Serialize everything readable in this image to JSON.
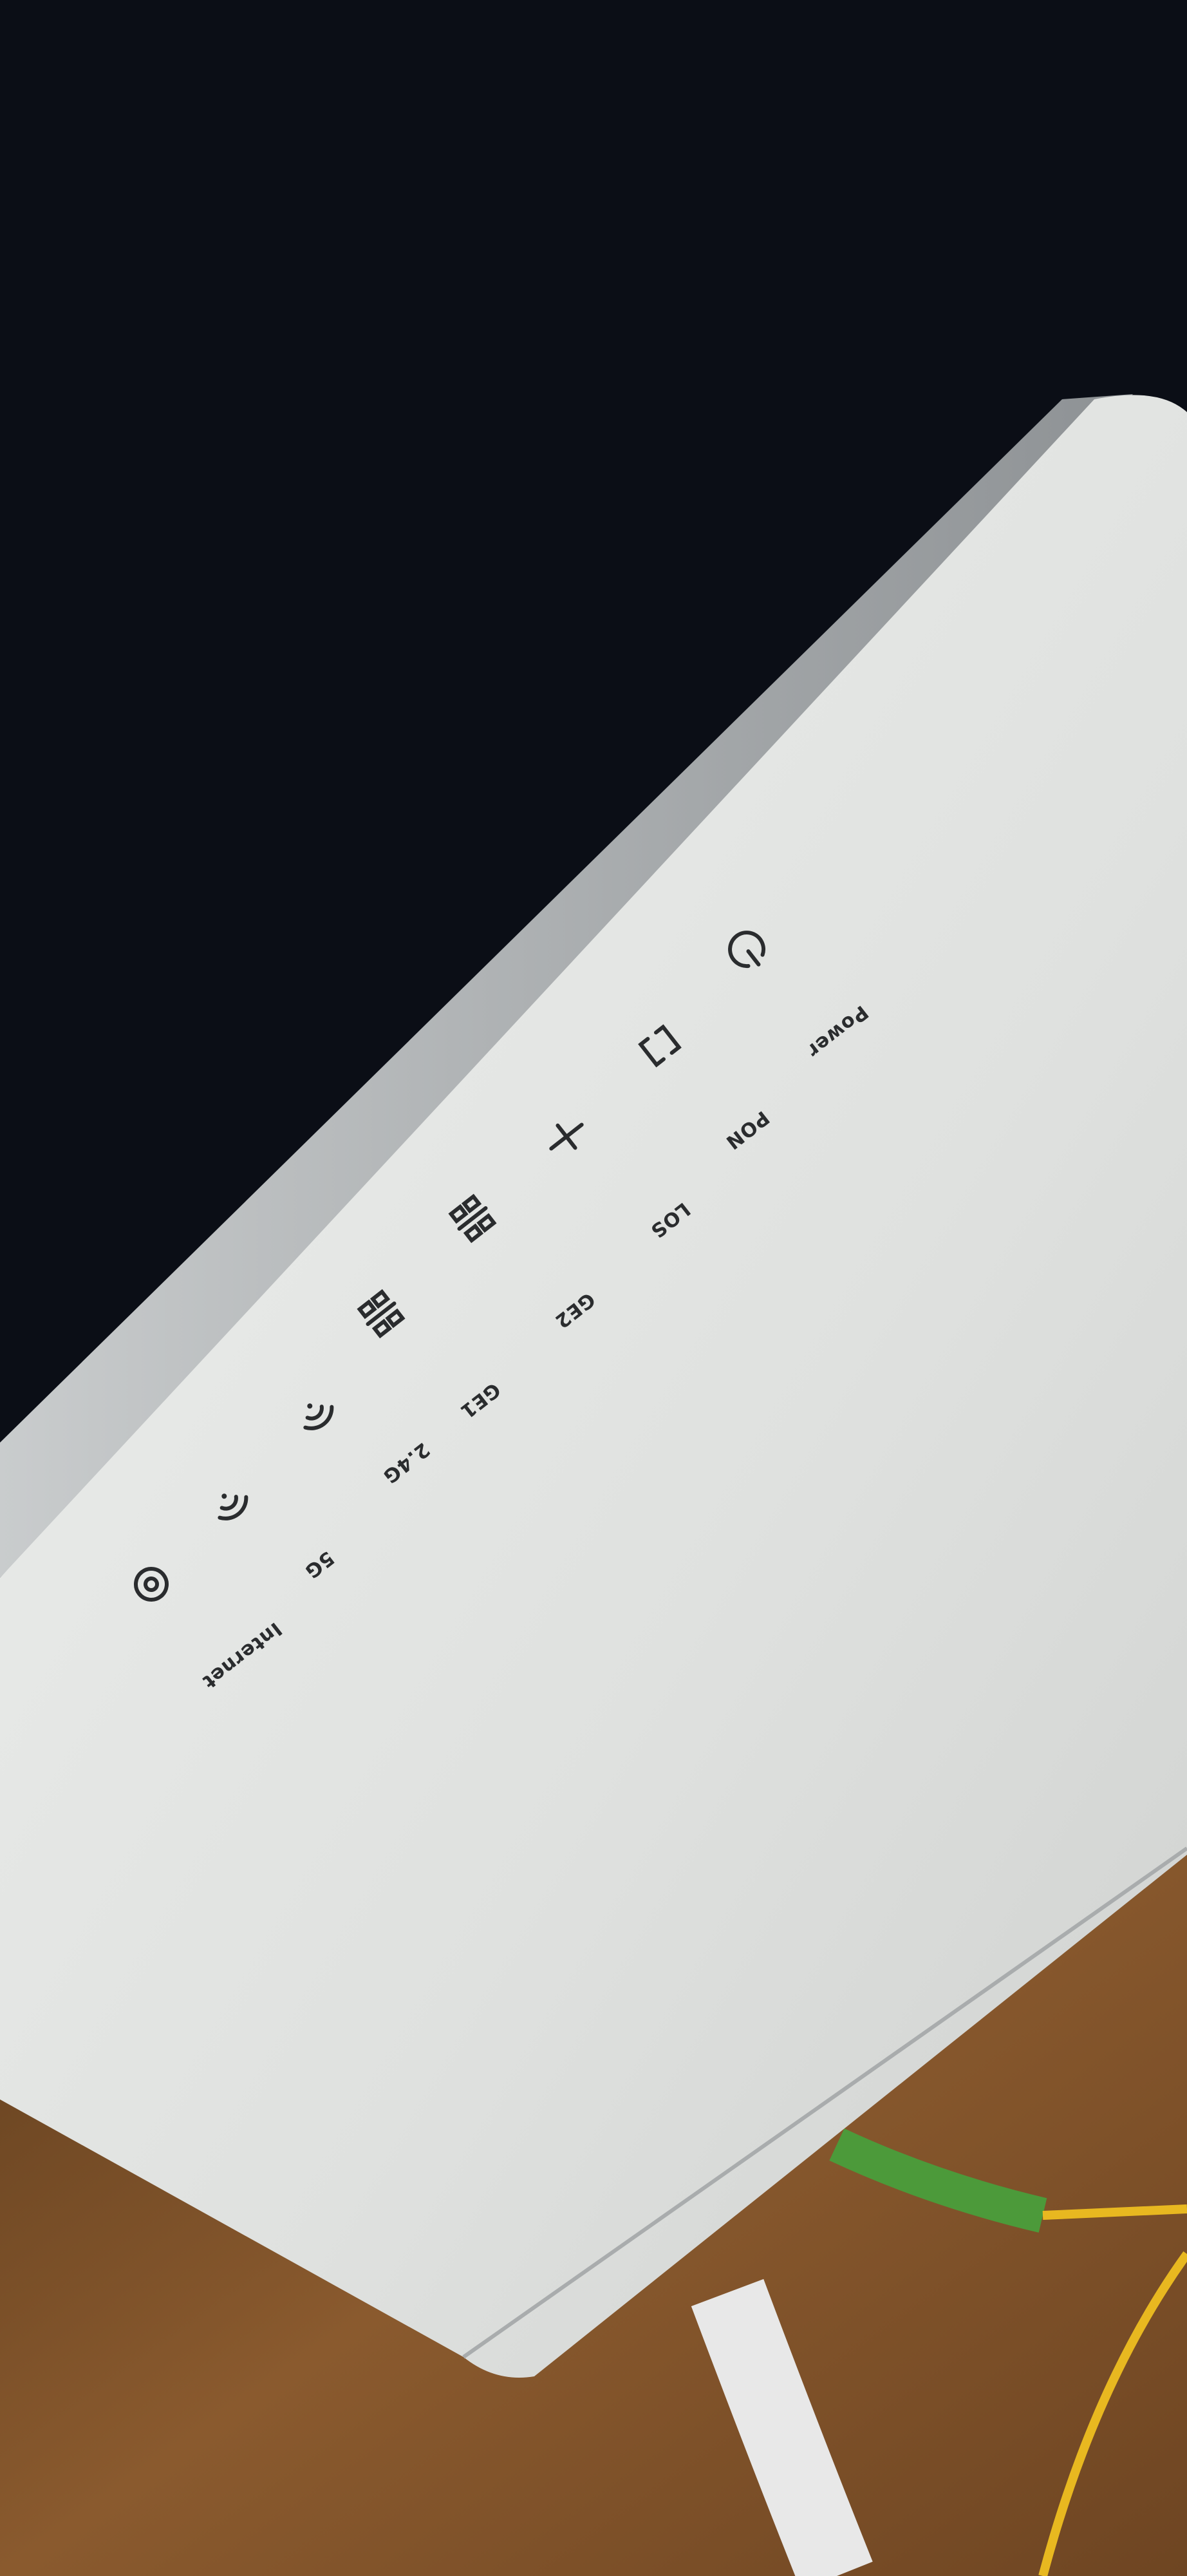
{
  "indicators": [
    {
      "label": "Power",
      "icon": "power-icon"
    },
    {
      "label": "PON",
      "icon": "pon-bracket-icon"
    },
    {
      "label": "LOS",
      "icon": "los-icon"
    },
    {
      "label": "GE2",
      "icon": "ethernet-icon"
    },
    {
      "label": "GE1",
      "icon": "ethernet-icon"
    },
    {
      "label": "2.4G",
      "icon": "wifi-icon"
    },
    {
      "label": "5G",
      "icon": "wifi-icon"
    },
    {
      "label": "Internet",
      "icon": "globe-icon"
    }
  ],
  "colors": {
    "background": "#0b0e16",
    "router_top": "#e4e6e4",
    "router_side": "#b5b9bb",
    "wood": "#8a5a2e",
    "fiber_cable": "#e8b820",
    "green_connector": "#4c9a3a"
  }
}
